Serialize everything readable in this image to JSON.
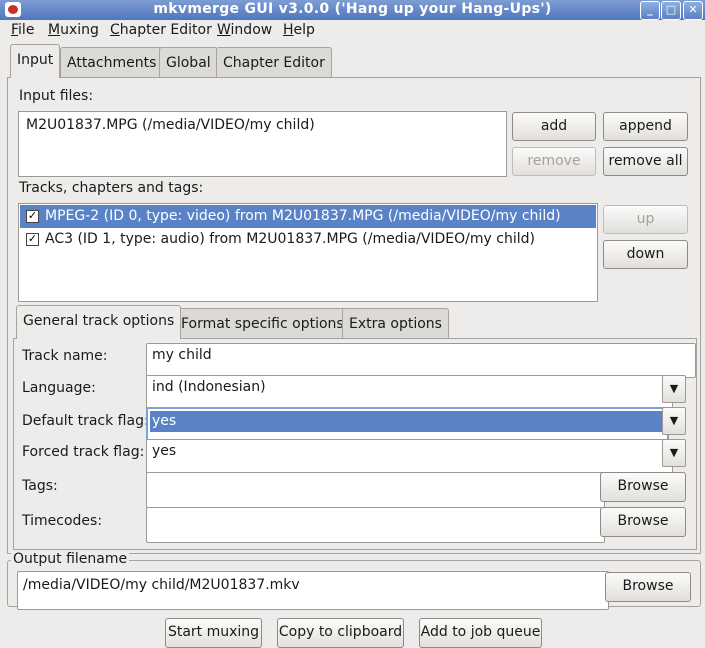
{
  "window": {
    "title": "mkvmerge GUI v3.0.0 ('Hang up your Hang-Ups')"
  },
  "menu": [
    {
      "label": "File",
      "mnemonic": "F"
    },
    {
      "label": "Muxing",
      "mnemonic": "M"
    },
    {
      "label": "Chapter Editor",
      "mnemonic": "C"
    },
    {
      "label": "Window",
      "mnemonic": "W"
    },
    {
      "label": "Help",
      "mnemonic": "H"
    }
  ],
  "main_tabs": [
    "Input",
    "Attachments",
    "Global",
    "Chapter Editor"
  ],
  "input": {
    "files_label": "Input files:",
    "files": [
      "M2U01837.MPG (/media/VIDEO/my child)"
    ],
    "add": "add",
    "append": "append",
    "remove": "remove",
    "remove_all": "remove all",
    "tracks_label": "Tracks, chapters and tags:",
    "tracks": [
      {
        "text": "MPEG-2 (ID 0, type: video) from M2U01837.MPG (/media/VIDEO/my child)",
        "checked": true,
        "selected": true
      },
      {
        "text": "AC3 (ID 1, type: audio) from M2U01837.MPG (/media/VIDEO/my child)",
        "checked": true,
        "selected": false
      }
    ],
    "up": "up",
    "down": "down"
  },
  "sub_tabs": [
    "General track options",
    "Format specific options",
    "Extra options"
  ],
  "general": {
    "track_name_label": "Track name:",
    "track_name": "my child",
    "language_label": "Language:",
    "language": "ind (Indonesian)",
    "default_flag_label": "Default track flag:",
    "default_flag": "yes",
    "forced_flag_label": "Forced track flag:",
    "forced_flag": "yes",
    "tags_label": "Tags:",
    "tags_value": "",
    "timecodes_label": "Timecodes:",
    "timecodes_value": "",
    "browse": "Browse"
  },
  "output": {
    "label": "Output filename",
    "value": "/media/VIDEO/my child/M2U01837.mkv",
    "browse": "Browse"
  },
  "bottom": {
    "start": "Start muxing",
    "copy": "Copy to clipboard",
    "queue": "Add to job queue"
  },
  "colors": {
    "selection": "#5a83c7",
    "titlebar": "#4f76bd"
  }
}
